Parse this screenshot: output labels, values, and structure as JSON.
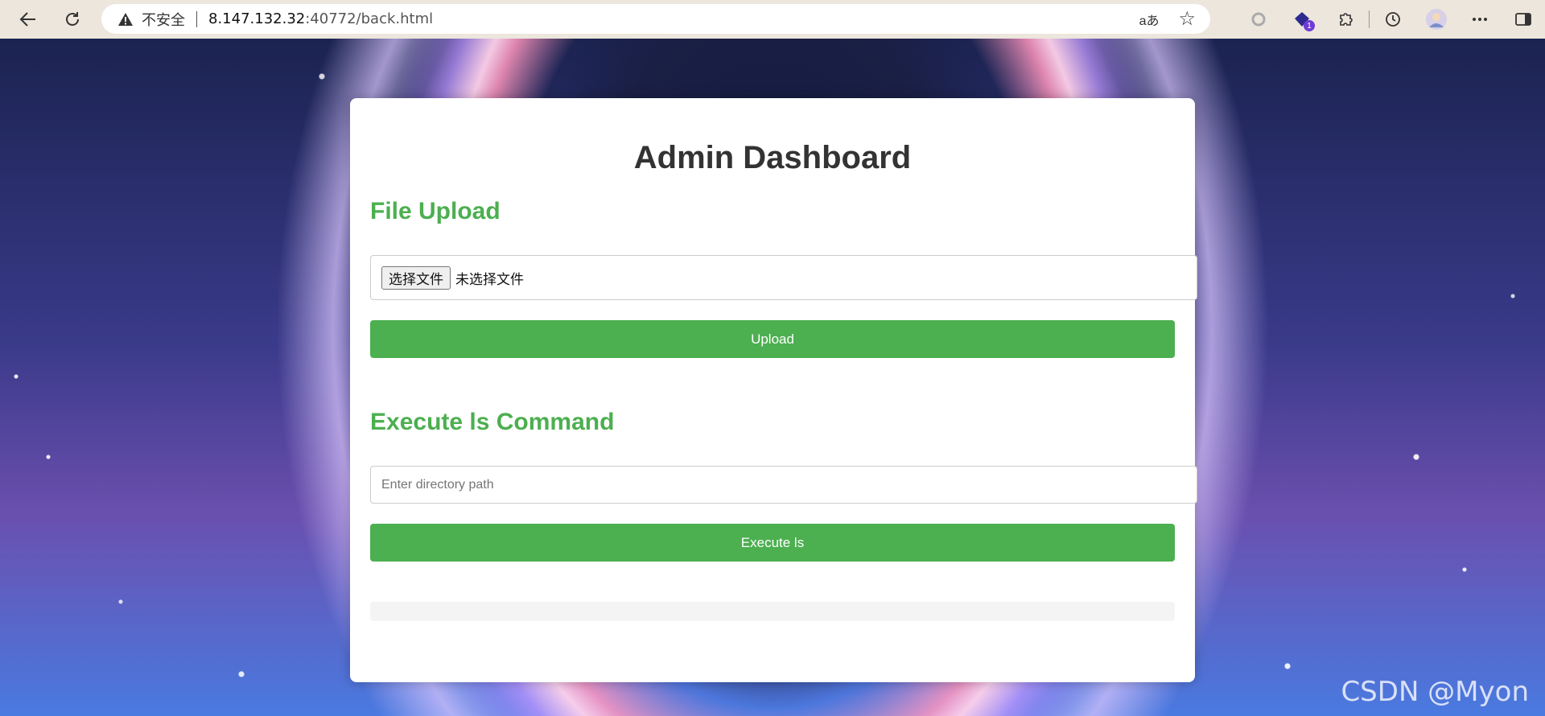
{
  "browser": {
    "insecure_label": "不安全",
    "url_host": "8.147.132.32",
    "url_rest": ":40772/back.html",
    "read_aloud_label": "aあ",
    "extension_badge_count": "1",
    "icons": [
      "back-arrow-icon",
      "reload-icon",
      "warning-icon",
      "read-aloud-icon",
      "favorite-star-icon",
      "extension-circle-icon",
      "extension-gem-icon",
      "extensions-puzzle-icon",
      "history-icon",
      "profile-avatar-icon",
      "more-menu-icon",
      "sidebar-toggle-icon"
    ]
  },
  "dashboard": {
    "title": "Admin Dashboard",
    "upload_section_title": "File Upload",
    "file_choose_label": "选择文件",
    "file_status": "未选择文件",
    "upload_button": "Upload",
    "execute_section_title": "Execute ls Command",
    "path_placeholder": "Enter directory path",
    "path_value": "",
    "execute_button": "Execute ls",
    "output_text": ""
  },
  "watermark": "CSDN @Myon",
  "colors": {
    "accent_green": "#4caf50",
    "title_text": "#333333",
    "chrome_bg": "#ece6dc"
  }
}
